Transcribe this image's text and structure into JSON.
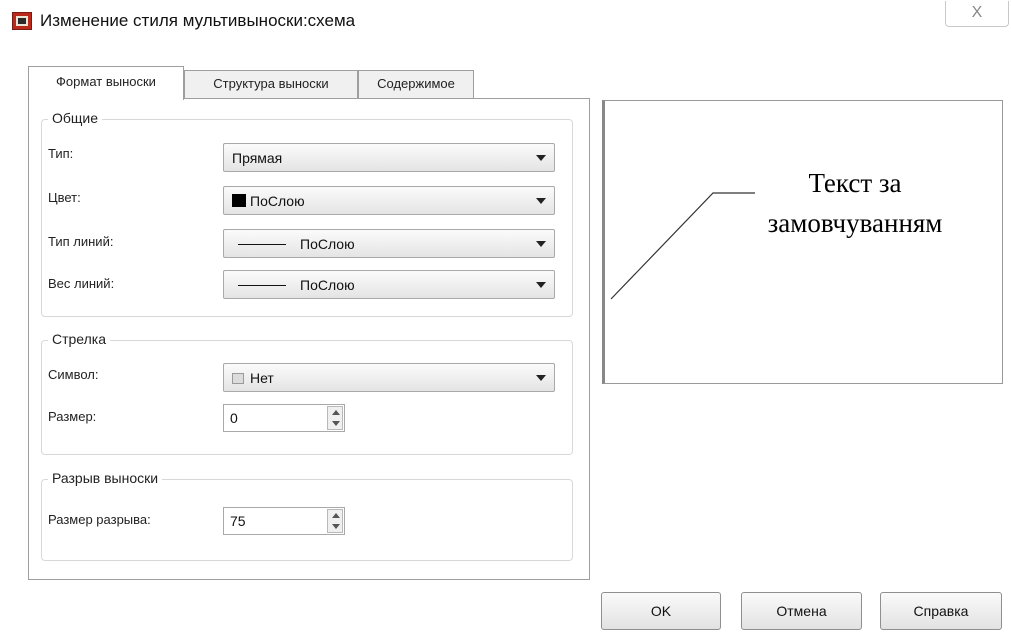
{
  "window": {
    "title": "Изменение стиля мультивыноски:схема",
    "close_glyph": "X"
  },
  "tabs": [
    {
      "label": "Формат выноски",
      "active": true
    },
    {
      "label": "Структура выноски",
      "active": false
    },
    {
      "label": "Содержимое",
      "active": false
    }
  ],
  "general": {
    "title": "Общие",
    "type_label": "Тип:",
    "type_value": "Прямая",
    "color_label": "Цвет:",
    "color_value": "ПоСлою",
    "color_swatch": "#000000",
    "linetype_label": "Тип линий:",
    "linetype_value": "ПоСлою",
    "lineweight_label": "Вес линий:",
    "lineweight_value": "ПоСлою"
  },
  "arrowhead": {
    "title": "Стрелка",
    "symbol_label": "Символ:",
    "symbol_value": "Нет",
    "size_label": "Размер:",
    "size_value": "0"
  },
  "landing_break": {
    "title": "Разрыв выноски",
    "break_size_label": "Размер разрыва:",
    "break_size_value": "75"
  },
  "preview": {
    "text_line1": "Текст за",
    "text_line2": "замовчуванням"
  },
  "buttons": {
    "ok": "OK",
    "cancel": "Отмена",
    "help": "Справка"
  }
}
